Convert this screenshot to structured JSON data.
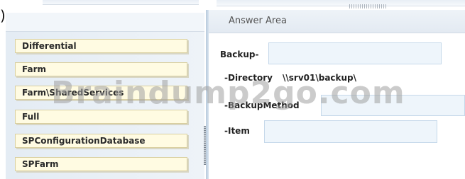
{
  "edge_char": ")",
  "source_items": [
    {
      "label": "Differential"
    },
    {
      "label": "Farm"
    },
    {
      "label": "Farm\\SharedServices"
    },
    {
      "label": "Full"
    },
    {
      "label": "SPConfigurationDatabase"
    },
    {
      "label": "SPFarm"
    }
  ],
  "answer_area": {
    "title": "Answer Area",
    "command": "Backup-",
    "directory_label": "-Directory",
    "directory_value": "\\\\srv01\\backup\\",
    "backup_method_label": "-BackupMethod",
    "item_label": "-Item"
  },
  "watermark": "Braindump2go.com"
}
